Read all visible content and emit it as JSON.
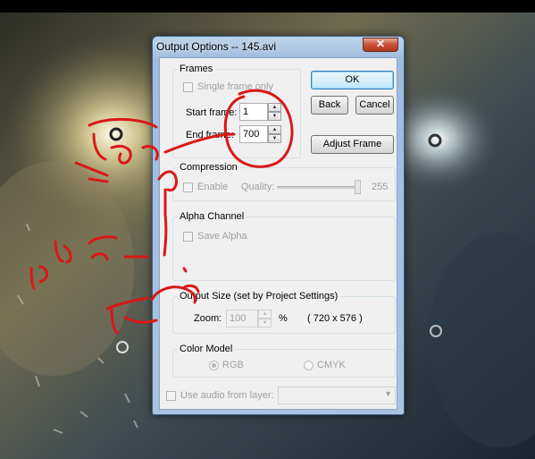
{
  "window": {
    "title": "Output Options -- 145.avi",
    "close_glyph": "✕"
  },
  "frames": {
    "group_label": "Frames",
    "single_frame_label": "Single frame only",
    "start_label": "Start frame:",
    "start_value": "1",
    "end_label": "End frame:",
    "end_value": "700"
  },
  "buttons": {
    "ok": "OK",
    "back": "Back",
    "cancel": "Cancel",
    "adjust_frame": "Adjust Frame"
  },
  "compression": {
    "group_label": "Compression",
    "enable_label": "Enable",
    "quality_label": "Quality:",
    "quality_value": "255"
  },
  "alpha": {
    "group_label": "Alpha Channel",
    "save_alpha_label": "Save Alpha"
  },
  "output_size": {
    "group_label": "Output Size  (set by Project Settings)",
    "zoom_label": "Zoom:",
    "zoom_value": "100",
    "percent": "%",
    "dimensions": "( 720 x 576 )"
  },
  "color_model": {
    "group_label": "Color Model",
    "options": [
      "RGB",
      "CMYK"
    ],
    "selected": "RGB"
  },
  "audio": {
    "use_audio_label": "Use audio from layer:"
  },
  "colors": {
    "annotation_ink": "#d91818",
    "dialog_frame": "#a9c3e1"
  }
}
